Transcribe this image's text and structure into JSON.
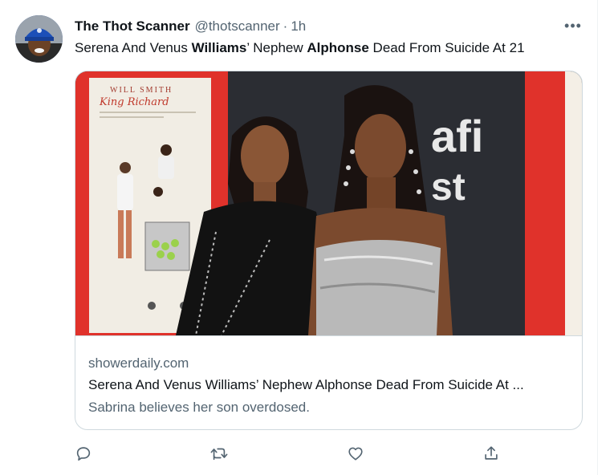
{
  "tweet": {
    "author_name": "The Thot Scanner",
    "author_handle": "@thotscanner",
    "separator": "·",
    "time": "1h",
    "more_label": "•••",
    "text_parts": [
      "Serena And Venus ",
      "Williams",
      "’ Nephew ",
      "Alphonse",
      " Dead From Suicide At 21"
    ]
  },
  "card": {
    "poster_top": "WILL SMITH",
    "poster_title": "King Richard",
    "backdrop_letters": "afi",
    "backdrop_letters_2": "st",
    "domain": "showerdaily.com",
    "title": "Serena And Venus Williams’ Nephew Alphonse Dead From Suicide At ...",
    "description": "Sabrina believes her son overdosed."
  },
  "icons": {
    "reply": "reply-icon",
    "retweet": "retweet-icon",
    "like": "like-icon",
    "share": "share-icon"
  },
  "colors": {
    "text_primary": "#0f1419",
    "text_secondary": "#536471",
    "border": "#cfd9de",
    "poster_red": "#e0322b"
  }
}
